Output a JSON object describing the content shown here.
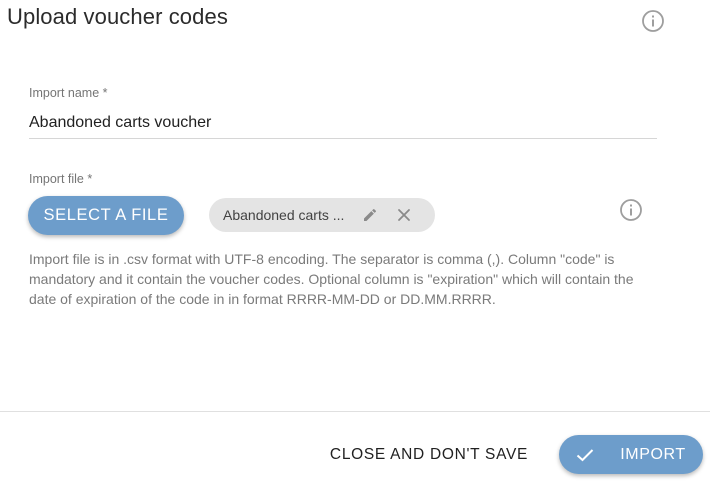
{
  "dialog": {
    "title": "Upload voucher codes",
    "info_icon": "info-circle-icon"
  },
  "form": {
    "import_name": {
      "label": "Import name  *",
      "value": "Abandoned carts voucher"
    },
    "import_file": {
      "label": "Import file *",
      "select_button": "SELECT A FILE",
      "file_chip": {
        "name": "Abandoned carts ...",
        "edit_icon": "pencil-icon",
        "remove_icon": "close-icon"
      },
      "info_icon": "info-circle-icon",
      "help_text": "Import file is in .csv format with UTF-8 encoding. The separator is comma (,). Column \"code\" is mandatory and it contain the voucher codes. Optional column is \"expiration\" which will contain the date of expiration of the code in in format RRRR-MM-DD or DD.MM.RRRR."
    }
  },
  "footer": {
    "close_label": "CLOSE AND DON'T SAVE",
    "import_label": "IMPORT",
    "import_icon": "check-icon"
  },
  "colors": {
    "accent": "#6d9dcb",
    "chip_bg": "#e4e4e4",
    "muted_text": "#7a7a7a",
    "icon_gray": "#9e9e9e"
  }
}
